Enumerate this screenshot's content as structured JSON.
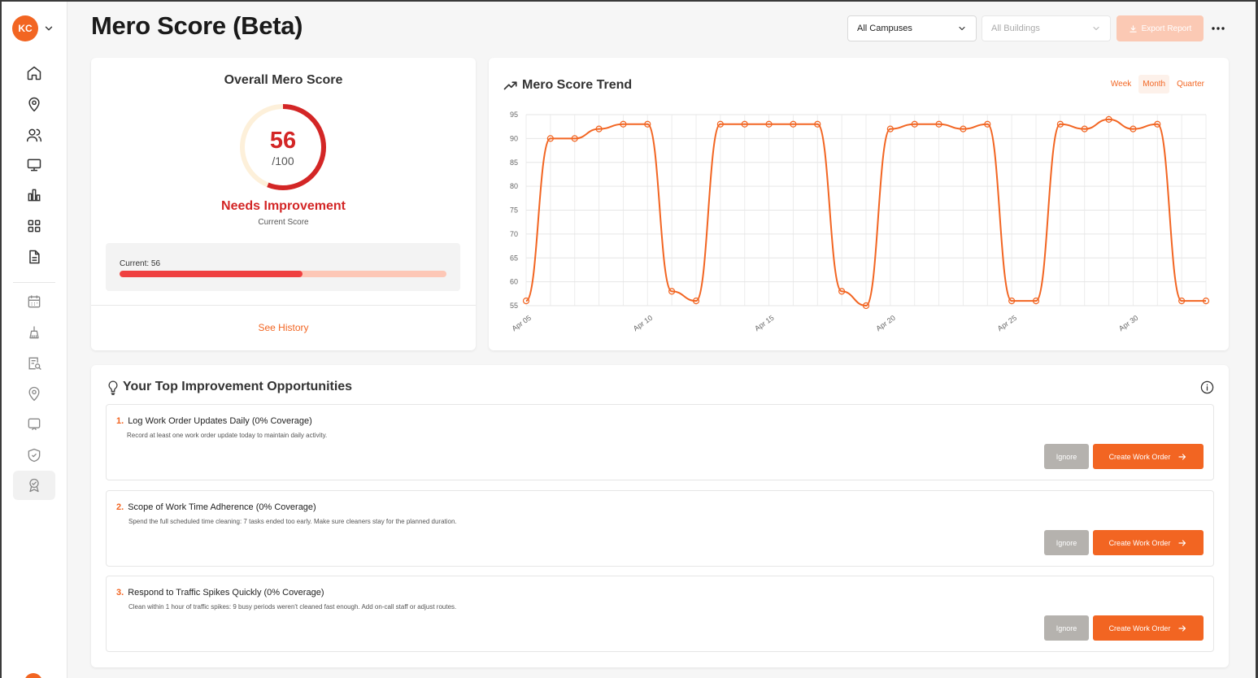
{
  "app": {
    "avatar_initials": "KC",
    "page_title": "Mero Score (Beta)",
    "accent_color": "#f26522",
    "danger_color": "#d32626"
  },
  "filters": {
    "campus_value": "All Campuses",
    "building_value": "All Buildings",
    "export_label": "Export Report"
  },
  "sidebar": {
    "items": [
      {
        "name": "home",
        "icon": "home-icon"
      },
      {
        "name": "locations",
        "icon": "map-pin-icon"
      },
      {
        "name": "users",
        "icon": "users-icon"
      },
      {
        "name": "monitor",
        "icon": "monitor-icon"
      },
      {
        "name": "analytics",
        "icon": "bar-chart-icon"
      },
      {
        "name": "apps",
        "icon": "grid-icon"
      },
      {
        "name": "reports",
        "icon": "document-icon"
      },
      {
        "name": "calendar",
        "icon": "calendar-icon"
      },
      {
        "name": "cleaning",
        "icon": "broom-icon"
      },
      {
        "name": "inspections",
        "icon": "clipboard-search-icon"
      },
      {
        "name": "sites",
        "icon": "location-icon"
      },
      {
        "name": "displays",
        "icon": "screen-icon"
      },
      {
        "name": "security",
        "icon": "shield-check-icon"
      },
      {
        "name": "mero-score",
        "icon": "award-icon",
        "active": true
      }
    ]
  },
  "score": {
    "title": "Overall Mero Score",
    "value": "56",
    "max": "/100",
    "fraction": 0.56,
    "status": "Needs Improvement",
    "status_sub": "Current Score",
    "progress_label": "Current: 56",
    "progress_fraction": 0.56,
    "history_link": "See History"
  },
  "trend": {
    "title": "Mero Score Trend",
    "tabs": [
      {
        "label": "Week",
        "active": false
      },
      {
        "label": "Month",
        "active": true
      },
      {
        "label": "Quarter",
        "active": false
      }
    ]
  },
  "chart_data": {
    "type": "line",
    "title": "Mero Score Trend",
    "xlabel": "",
    "ylabel": "",
    "ylim": [
      55,
      95
    ],
    "yticks": [
      95,
      90,
      85,
      80,
      75,
      70,
      65,
      60,
      55
    ],
    "xtick_labels": [
      "Apr 05",
      "Apr 10",
      "Apr 15",
      "Apr 20",
      "Apr 25",
      "Apr 30"
    ],
    "xtick_days": [
      5,
      10,
      15,
      20,
      25,
      30
    ],
    "grid": true,
    "color": "#f26522",
    "x": [
      5,
      6,
      7,
      8,
      9,
      10,
      11,
      12,
      13,
      14,
      15,
      16,
      17,
      18,
      19,
      20,
      21,
      22,
      23,
      24,
      25,
      26,
      27,
      28,
      29,
      30,
      31,
      32,
      33
    ],
    "series": [
      {
        "values": [
          56,
          90,
          90,
          92,
          93,
          93,
          58,
          56,
          93,
          93,
          93,
          93,
          93,
          58,
          55,
          92,
          93,
          93,
          92,
          93,
          56,
          56,
          93,
          92,
          94,
          92,
          93,
          56,
          56
        ]
      }
    ]
  },
  "opportunities": {
    "title": "Your Top Improvement Opportunities",
    "items": [
      {
        "num": "1.",
        "title": "Log Work Order Updates Daily (0% Coverage)",
        "desc": "Record at least one work order update today to maintain daily activity.",
        "ignore": "Ignore",
        "create": "Create Work Order"
      },
      {
        "num": "2.",
        "title": "Scope of Work Time Adherence (0% Coverage)",
        "desc": "Spend the full scheduled time cleaning: 7 tasks ended too early. Make sure cleaners stay for the planned duration.",
        "ignore": "Ignore",
        "create": "Create Work Order"
      },
      {
        "num": "3.",
        "title": "Respond to Traffic Spikes Quickly (0% Coverage)",
        "desc": "Clean within 1 hour of traffic spikes: 9 busy periods weren't cleaned fast enough. Add on-call staff or adjust routes.",
        "ignore": "Ignore",
        "create": "Create Work Order"
      }
    ]
  }
}
